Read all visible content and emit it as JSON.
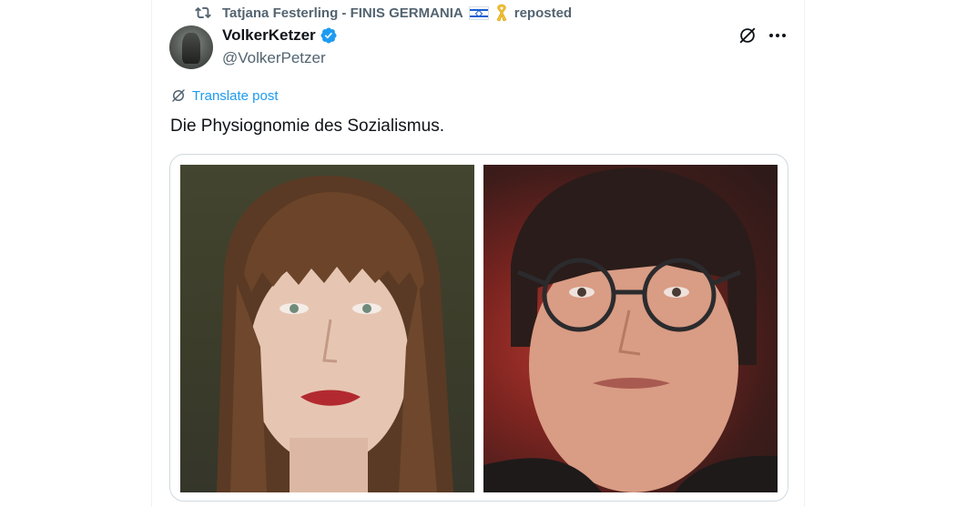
{
  "repost": {
    "reposter_name": "Tatjana Festerling - FINIS GERMANIA",
    "reposted_label": "reposted"
  },
  "author": {
    "display_name": "VolkerKetzer",
    "handle": "@VolkerPetzer",
    "verified": true
  },
  "translate": {
    "label": "Translate post"
  },
  "post": {
    "text": "Die Physiognomie des Sozialismus."
  },
  "colors": {
    "accent": "#1d9bf0",
    "secondary_text": "#536471",
    "primary_text": "#0f1419",
    "border": "#cfd9de"
  },
  "icons": {
    "repost": "repost-icon",
    "flag": "israel-flag-emoji",
    "ribbon": "yellow-ribbon-emoji",
    "verified": "verified-badge-icon",
    "grok": "grok-icon",
    "more": "more-options-icon",
    "translate": "translate-icon"
  }
}
